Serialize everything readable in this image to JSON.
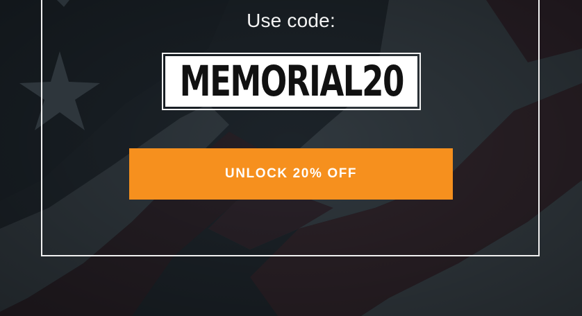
{
  "promo": {
    "intro_text": "Use code:",
    "code": "MEMORIAL20",
    "cta_label": "UNLOCK 20% OFF"
  },
  "background": {
    "image": "american-flag-texture",
    "icon": "star-icon"
  },
  "colors": {
    "background": "#1e252b",
    "stripe_light": "#32393f",
    "stripe_red": "#2b2026",
    "frame": "#f2f2f2",
    "button": "#f6901e",
    "text": "#ffffff"
  }
}
